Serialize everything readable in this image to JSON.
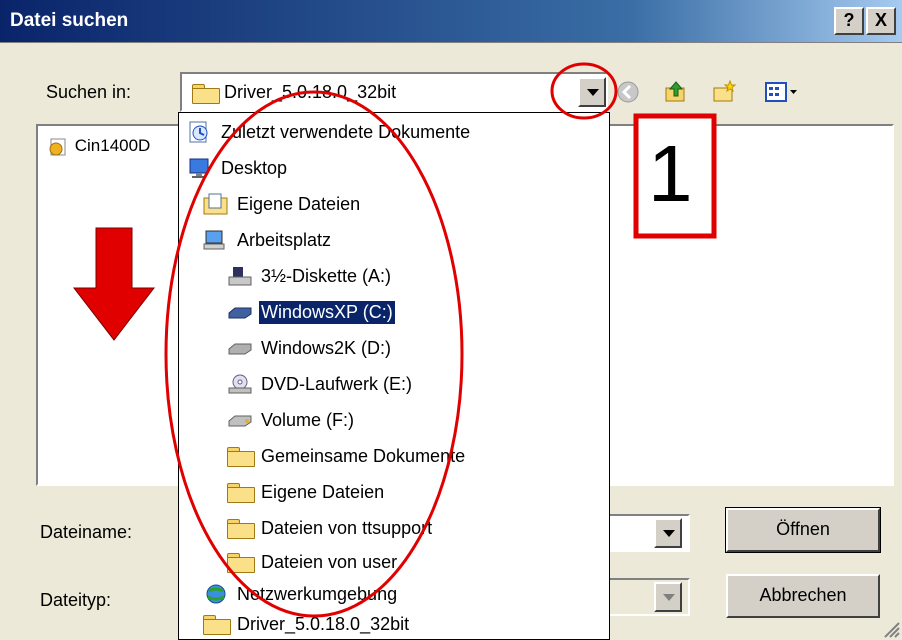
{
  "window": {
    "title": "Datei suchen",
    "help_button": "?",
    "close_button": "X"
  },
  "look_in": {
    "label": "Suchen in:",
    "value": "Driver_5.0.18.0_32bit"
  },
  "file_list": {
    "items": [
      {
        "name": "Cin1400D"
      }
    ]
  },
  "dropdown": {
    "items": [
      {
        "label": "Zuletzt verwendete Dokumente",
        "icon": "recent-docs-icon",
        "level": 0
      },
      {
        "label": "Desktop",
        "icon": "desktop-icon",
        "level": 0
      },
      {
        "label": "Eigene Dateien",
        "icon": "my-documents-icon",
        "level": 1
      },
      {
        "label": "Arbeitsplatz",
        "icon": "my-computer-icon",
        "level": 1
      },
      {
        "label": "3½-Diskette (A:)",
        "icon": "floppy-drive-icon",
        "level": 2
      },
      {
        "label": "WindowsXP (C:)",
        "icon": "hard-drive-icon",
        "level": 2,
        "selected": true
      },
      {
        "label": "Windows2K (D:)",
        "icon": "hard-drive-icon",
        "level": 2
      },
      {
        "label": "DVD-Laufwerk (E:)",
        "icon": "dvd-drive-icon",
        "level": 2
      },
      {
        "label": "Volume (F:)",
        "icon": "removable-drive-icon",
        "level": 2
      },
      {
        "label": "Gemeinsame Dokumente",
        "icon": "folder-icon",
        "level": 2
      },
      {
        "label": "Eigene Dateien",
        "icon": "folder-icon",
        "level": 2
      },
      {
        "label": "Dateien von ttsupport",
        "icon": "folder-icon",
        "level": 2
      },
      {
        "label": "Dateien von user",
        "icon": "folder-icon",
        "level": 2
      },
      {
        "label": "Netzwerkumgebung",
        "icon": "network-icon",
        "level": 1
      },
      {
        "label": "Driver_5.0.18.0_32bit",
        "icon": "folder-icon",
        "level": 1
      }
    ]
  },
  "filename": {
    "label": "Dateiname:",
    "value": ""
  },
  "filetype": {
    "label": "Dateityp:",
    "value": ""
  },
  "buttons": {
    "open": "Öffnen",
    "cancel": "Abbrechen"
  },
  "annotation": {
    "number": "1",
    "color": "#e00000"
  },
  "colors": {
    "title_bar": "#0a246a",
    "selection": "#0a246a",
    "annotation": "#e00000"
  }
}
